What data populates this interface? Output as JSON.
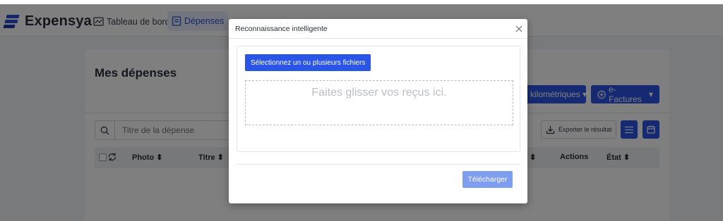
{
  "app": {
    "brand": "Expensya",
    "accent_color": "#2b55e6"
  },
  "nav": {
    "dashboard": "Tableau de bord",
    "expenses": "Dépenses"
  },
  "page": {
    "title": "Mes dépenses",
    "btn_km": "kilométriques",
    "btn_efactures": "e-Factures",
    "search_placeholder": "Titre de la dépense",
    "export_label": "Exporter le résultat",
    "table_headers": {
      "photo": "Photo",
      "titre": "Titre",
      "actions": "Actions",
      "etat": "État"
    }
  },
  "modal": {
    "title": "Reconnaissance intelligente",
    "select_files": "Sélectionnez un ou plusieurs fichiers",
    "dropzone": "Faites glisser vos reçus ici.",
    "upload": "Télécharger"
  }
}
